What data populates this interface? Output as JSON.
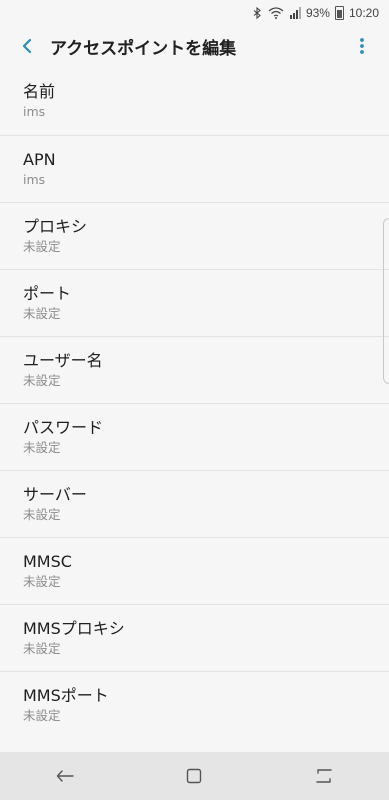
{
  "status_bar": {
    "battery_percent": "93%",
    "time": "10:20",
    "icons": [
      "bluetooth-icon",
      "wifi-icon",
      "signal-icon",
      "battery-icon"
    ]
  },
  "app_bar": {
    "title": "アクセスポイントを編集",
    "back_icon": "back-chevron-icon",
    "more_icon": "more-vertical-icon",
    "accent_color": "#2a8fb0"
  },
  "items": [
    {
      "title": "名前",
      "value": "ims"
    },
    {
      "title": "APN",
      "value": "ims"
    },
    {
      "title": "プロキシ",
      "value": "未設定"
    },
    {
      "title": "ポート",
      "value": "未設定"
    },
    {
      "title": "ユーザー名",
      "value": "未設定"
    },
    {
      "title": "パスワード",
      "value": "未設定"
    },
    {
      "title": "サーバー",
      "value": "未設定"
    },
    {
      "title": "MMSC",
      "value": "未設定"
    },
    {
      "title": "MMSプロキシ",
      "value": "未設定"
    },
    {
      "title": "MMSポート",
      "value": "未設定"
    }
  ],
  "nav_bar": {
    "icons": [
      "nav-back-icon",
      "nav-home-icon",
      "nav-recents-icon"
    ]
  }
}
